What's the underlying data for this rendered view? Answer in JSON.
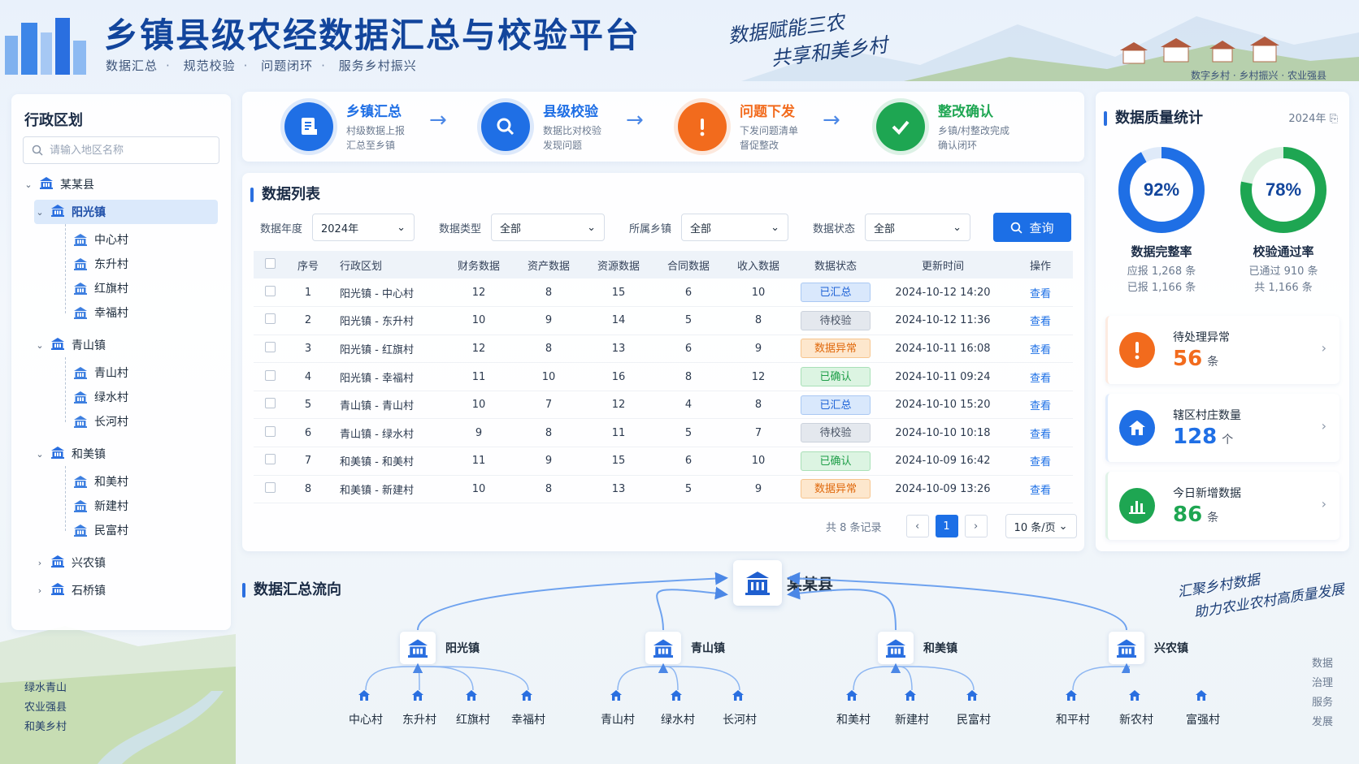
{
  "header": {
    "title": "乡镇县级农经数据汇总与校验平台",
    "subtitle_items": [
      "数据汇总",
      "规范校验",
      "问题闭环",
      "服务乡村振兴"
    ],
    "slogan_line1": "数据赋能三农",
    "slogan_line2": "共享和美乡村",
    "tagline": "数字乡村 · 乡村振兴 · 农业强县"
  },
  "left_panel": {
    "title": "行政区划",
    "search_placeholder": "请输入地区名称",
    "tree": {
      "county": "某某县",
      "towns": [
        {
          "name": "阳光镇",
          "villages": [
            "中心村",
            "东升村",
            "红旗村",
            "幸福村"
          ]
        },
        {
          "name": "青山镇",
          "villages": [
            "青山村",
            "绿水村",
            "长河村"
          ]
        },
        {
          "name": "和美镇",
          "villages": [
            "和美村",
            "新建村",
            "民富村"
          ]
        },
        {
          "name": "兴农镇",
          "villages": []
        },
        {
          "name": "石桥镇",
          "villages": []
        }
      ]
    },
    "mottos": [
      "绿水青山",
      "农业强县",
      "和美乡村"
    ]
  },
  "steps": [
    {
      "title": "乡镇汇总",
      "desc1": "村级数据上报",
      "desc2": "汇总至乡镇",
      "color": "#1f6fe5",
      "icon": "document-edit-icon"
    },
    {
      "title": "县级校验",
      "desc1": "数据比对校验",
      "desc2": "发现问题",
      "color": "#1f6fe5",
      "icon": "search-icon"
    },
    {
      "title": "问题下发",
      "desc1": "下发问题清单",
      "desc2": "督促整改",
      "color": "#f26b1d",
      "icon": "exclamation-icon"
    },
    {
      "title": "整改确认",
      "desc1": "乡镇/村整改完成",
      "desc2": "确认闭环",
      "color": "#1ea652",
      "icon": "check-icon"
    }
  ],
  "data_list": {
    "title": "数据列表",
    "filters": [
      {
        "label": "数据年度",
        "value": "2024年"
      },
      {
        "label": "数据类型",
        "value": "全部"
      },
      {
        "label": "所属乡镇",
        "value": "全部"
      },
      {
        "label": "数据状态",
        "value": "全部"
      }
    ],
    "query_label": "查询",
    "columns": [
      "序号",
      "行政区划",
      "财务数据",
      "资产数据",
      "资源数据",
      "合同数据",
      "收入数据",
      "数据状态",
      "更新时间",
      "操作"
    ],
    "rows": [
      {
        "no": "1",
        "region": "阳光镇 - 中心村",
        "fin": "12",
        "asset": "8",
        "res": "15",
        "contract": "6",
        "income": "10",
        "status": "已汇总",
        "status_type": "blue",
        "time": "2024-10-12 14:20",
        "action": "查看"
      },
      {
        "no": "2",
        "region": "阳光镇 - 东升村",
        "fin": "10",
        "asset": "9",
        "res": "14",
        "contract": "5",
        "income": "8",
        "status": "待校验",
        "status_type": "gray",
        "time": "2024-10-12 11:36",
        "action": "查看"
      },
      {
        "no": "3",
        "region": "阳光镇 - 红旗村",
        "fin": "12",
        "asset": "8",
        "res": "13",
        "contract": "6",
        "income": "9",
        "status": "数据异常",
        "status_type": "orange",
        "time": "2024-10-11 16:08",
        "action": "查看"
      },
      {
        "no": "4",
        "region": "阳光镇 - 幸福村",
        "fin": "11",
        "asset": "10",
        "res": "16",
        "contract": "8",
        "income": "12",
        "status": "已确认",
        "status_type": "green",
        "time": "2024-10-11 09:24",
        "action": "查看"
      },
      {
        "no": "5",
        "region": "青山镇 - 青山村",
        "fin": "10",
        "asset": "7",
        "res": "12",
        "contract": "4",
        "income": "8",
        "status": "已汇总",
        "status_type": "blue",
        "time": "2024-10-10 15:20",
        "action": "查看"
      },
      {
        "no": "6",
        "region": "青山镇 - 绿水村",
        "fin": "9",
        "asset": "8",
        "res": "11",
        "contract": "5",
        "income": "7",
        "status": "待校验",
        "status_type": "gray",
        "time": "2024-10-10 10:18",
        "action": "查看"
      },
      {
        "no": "7",
        "region": "和美镇 - 和美村",
        "fin": "11",
        "asset": "9",
        "res": "15",
        "contract": "6",
        "income": "10",
        "status": "已确认",
        "status_type": "green",
        "time": "2024-10-09 16:42",
        "action": "查看"
      },
      {
        "no": "8",
        "region": "和美镇 - 新建村",
        "fin": "10",
        "asset": "8",
        "res": "13",
        "contract": "5",
        "income": "9",
        "status": "数据异常",
        "status_type": "orange",
        "time": "2024-10-09 13:26",
        "action": "查看"
      }
    ],
    "total_text": "共 8 条记录",
    "current_page": "1",
    "page_size": "10 条/页"
  },
  "quality": {
    "title": "数据质量统计",
    "year": "2024年",
    "completeness": {
      "label": "数据完整率",
      "percent": 92,
      "display": "92%",
      "line1": "应报 1,268 条",
      "line2": "已报 1,166 条",
      "color": "#1f6fe5"
    },
    "pass_rate": {
      "label": "校验通过率",
      "percent": 78,
      "display": "78%",
      "line1": "已通过 910 条",
      "line2": "共 1,166 条",
      "color": "#1ea652"
    },
    "cards": [
      {
        "label": "待处理异常",
        "value": "56",
        "unit": "条",
        "color": "#f26b1d",
        "icon": "exclamation-icon"
      },
      {
        "label": "辖区村庄数量",
        "value": "128",
        "unit": "个",
        "color": "#1f6fe5",
        "icon": "house-icon"
      },
      {
        "label": "今日新增数据",
        "value": "86",
        "unit": "条",
        "color": "#1ea652",
        "icon": "bar-chart-icon"
      }
    ]
  },
  "flow": {
    "title": "数据汇总流向",
    "county": "某某县",
    "towns": [
      {
        "name": "阳光镇",
        "villages": [
          "中心村",
          "东升村",
          "红旗村",
          "幸福村"
        ]
      },
      {
        "name": "青山镇",
        "villages": [
          "青山村",
          "绿水村",
          "长河村"
        ]
      },
      {
        "name": "和美镇",
        "villages": [
          "和美村",
          "新建村",
          "民富村"
        ]
      },
      {
        "name": "兴农镇",
        "villages": [
          "和平村",
          "新农村",
          "富强村"
        ]
      }
    ],
    "slogan_line1": "汇聚乡村数据",
    "slogan_line2": "助力农业农村高质量发展",
    "side_words": [
      "数据",
      "治理",
      "服务",
      "发展"
    ]
  }
}
